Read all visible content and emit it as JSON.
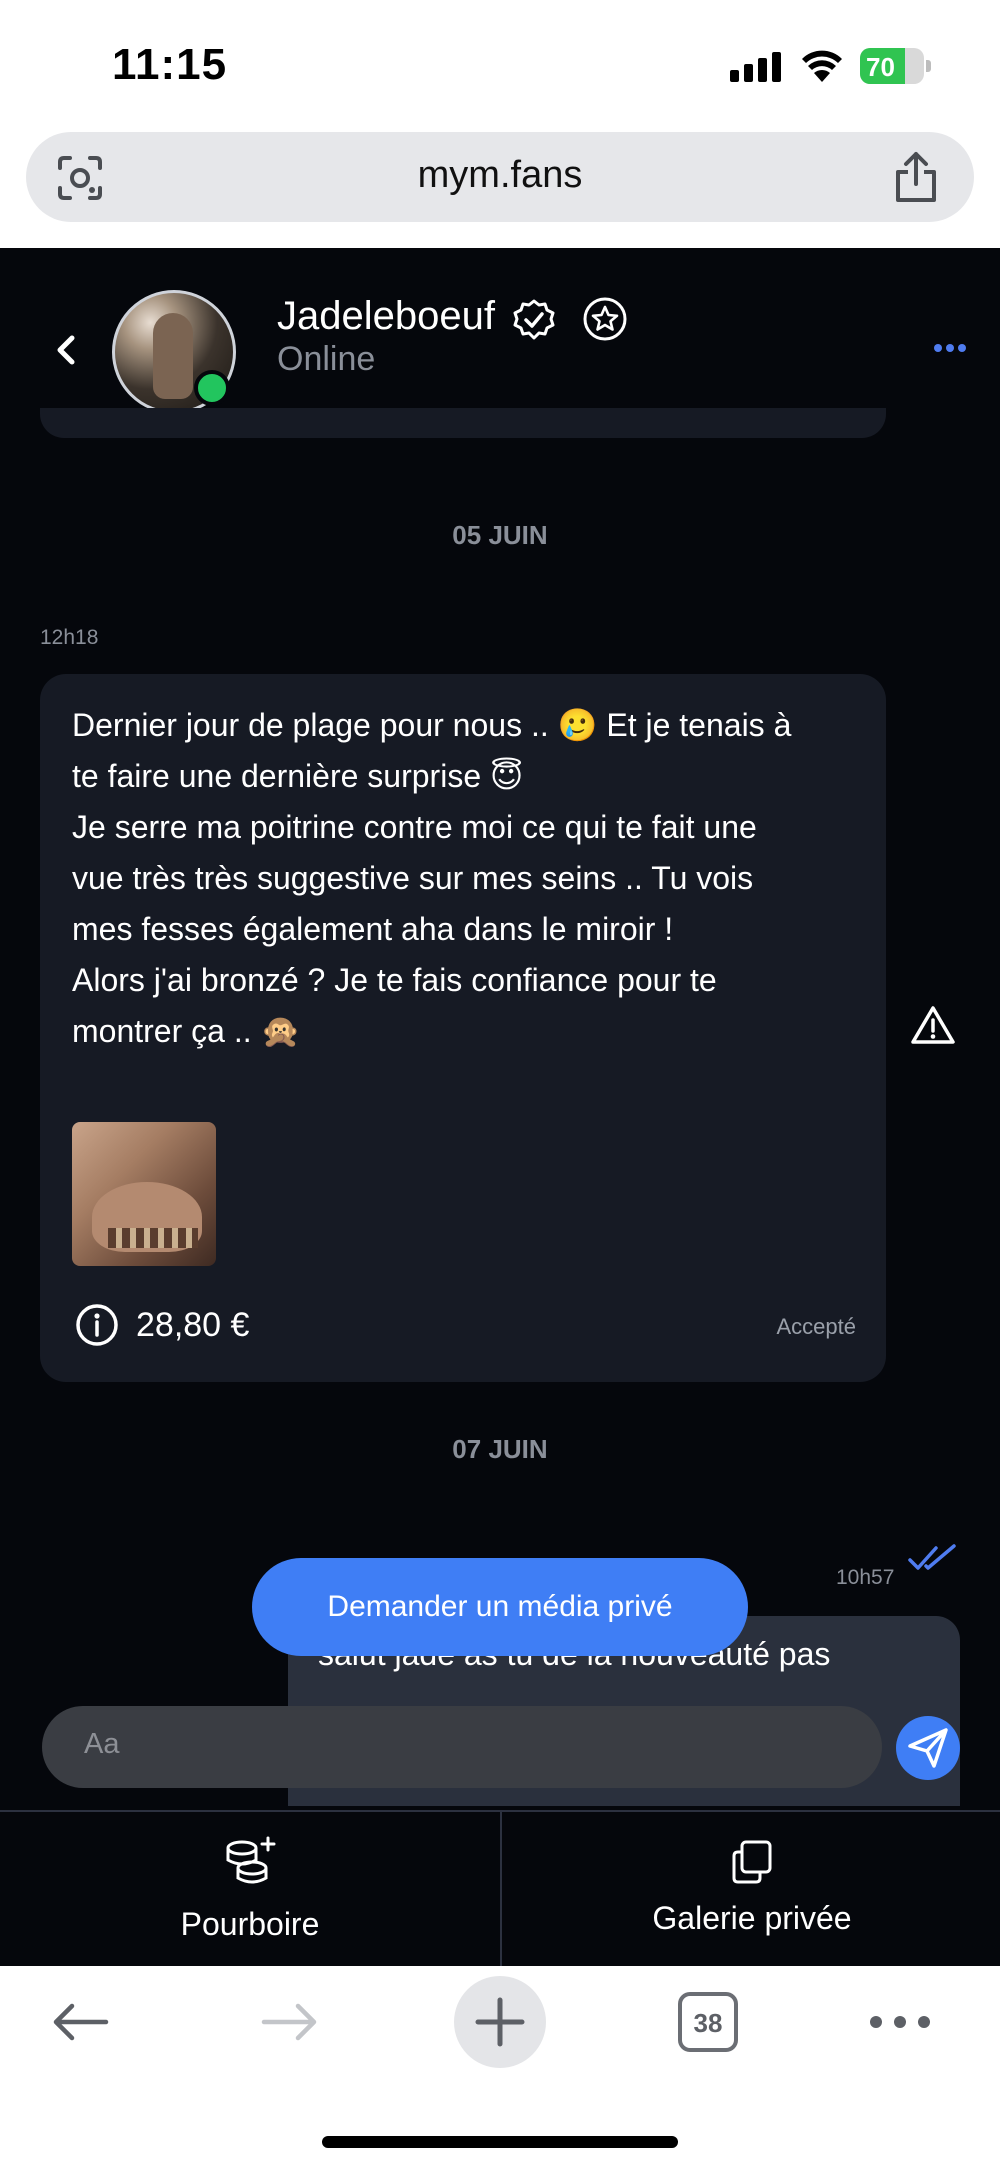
{
  "status_bar": {
    "time": "11:15",
    "battery": "70",
    "battery_fraction": 0.7
  },
  "browser": {
    "url": "mym.fans",
    "tabs_count": "38"
  },
  "chat": {
    "contact_name": "Jadeleboeuf",
    "contact_status": "Online",
    "dates": {
      "first": "05 JUIN",
      "second": "07 JUIN"
    },
    "incoming": {
      "time": "12h18",
      "text": "Dernier jour de plage pour nous .. 🥲 Et je tenais à\nte faire une dernière surprise 😇\nJe serre ma poitrine contre moi ce qui te fait une\nvue très très suggestive sur mes seins .. Tu vois\nmes fesses également aha dans le miroir !\nAlors j'ai bronzé ? Je te fais confiance pour te\nmontrer ça .. 🙊",
      "price": "28,80 €",
      "status": "Accepté"
    },
    "outgoing": {
      "time": "10h57",
      "text": "salut jade as tu de la nouveauté pas"
    },
    "request_button": "Demander un média privé",
    "input_placeholder": "Aa"
  },
  "actions": {
    "tip": "Pourboire",
    "gallery": "Galerie privée"
  },
  "colors": {
    "accent": "#3f7ef5",
    "online": "#22c55e",
    "background": "#05070c",
    "bubble": "#161a24"
  }
}
